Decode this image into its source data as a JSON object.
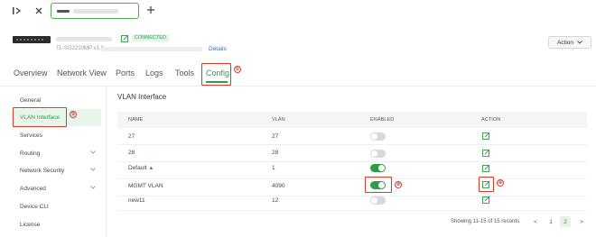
{
  "topbar": {
    "collapse_icon": "sidebar-collapse-icon",
    "close_icon": "close-icon",
    "add_icon": "plus-icon"
  },
  "device": {
    "model": "TL-SG2210MP v1.0",
    "status": "CONNECTED",
    "details_link": "Details",
    "action_label": "Action"
  },
  "nav": {
    "tabs": [
      "Overview",
      "Network View",
      "Ports",
      "Logs",
      "Tools",
      "Config"
    ],
    "active": "Config"
  },
  "sidebar": {
    "items": [
      "General",
      "VLAN Interface",
      "Services",
      "Routing",
      "Network Security",
      "Advanced",
      "Device CLI",
      "License"
    ],
    "active": "VLAN Interface"
  },
  "panel": {
    "title": "VLAN Interface",
    "columns": [
      "NAME",
      "VLAN",
      "ENABLED",
      "ACTION"
    ],
    "rows": [
      {
        "name": "27",
        "vlan": "27",
        "enabled": false
      },
      {
        "name": "28",
        "vlan": "28",
        "enabled": false
      },
      {
        "name": "Default",
        "vlan": "1",
        "enabled": true
      },
      {
        "name": "MGMT VLAN",
        "vlan": "4090",
        "enabled": true
      },
      {
        "name": "new11",
        "vlan": "12",
        "enabled": false
      }
    ]
  },
  "pagination": {
    "summary": "Showing 11-15 of 15 records",
    "prev": "<",
    "pages": [
      "1",
      "2"
    ],
    "active_page": "2",
    "next": ">"
  },
  "annotations": {
    "step1": "①",
    "step2": "②",
    "step3": "③",
    "step4": "④"
  },
  "colors": {
    "accent": "#2e9d48",
    "annotation": "#d93a2e",
    "link": "#2e6fc4"
  }
}
